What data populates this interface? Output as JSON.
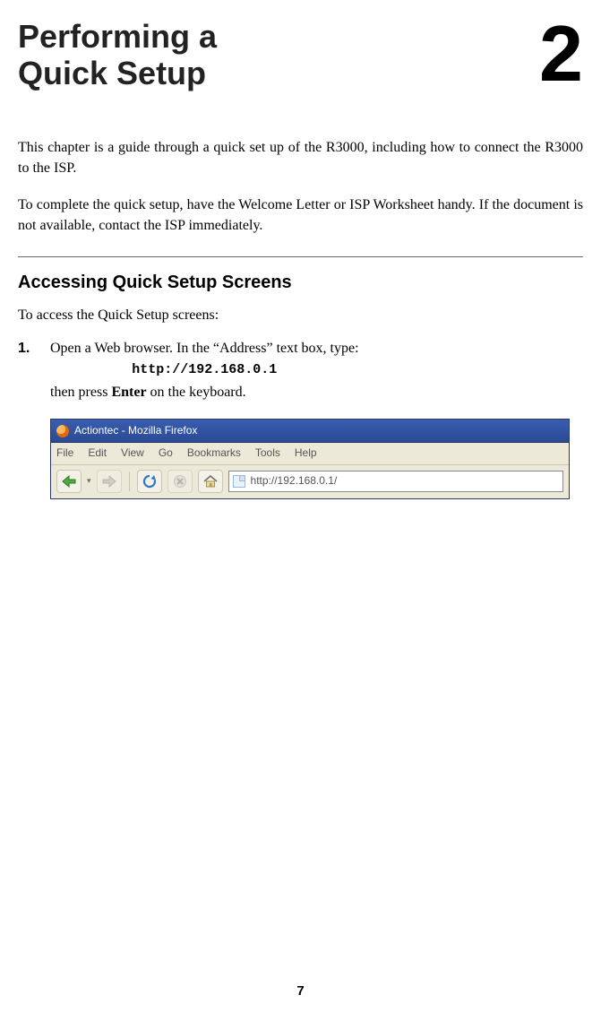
{
  "header": {
    "chapter_title_line1": "Performing a",
    "chapter_title_line2": "Quick Setup",
    "chapter_number": "2"
  },
  "intro": {
    "p1": "This chapter is a guide through a quick set up of the R3000, including how to connect the R3000 to the ISP.",
    "p2": "To complete the quick setup, have the Welcome Letter or ISP Worksheet handy. If the document is not available, contact the ISP immediately."
  },
  "section1": {
    "heading": "Accessing Quick Setup Screens",
    "lead": "To access the Quick Setup screens:",
    "step1": {
      "num": "1.",
      "line_a": "Open a Web browser. In the “Address” text box, type:",
      "url": "http://192.168.0.1",
      "line_b_before": "then press ",
      "line_b_strong": "Enter",
      "line_b_after": " on the keyboard."
    }
  },
  "browser": {
    "window_title": "Actiontec - Mozilla Firefox",
    "menu": {
      "file": "File",
      "edit": "Edit",
      "view": "View",
      "go": "Go",
      "bookmarks": "Bookmarks",
      "tools": "Tools",
      "help": "Help"
    },
    "back_dropdown": "▾",
    "address_value": "http://192.168.0.1/"
  },
  "page_number": "7"
}
